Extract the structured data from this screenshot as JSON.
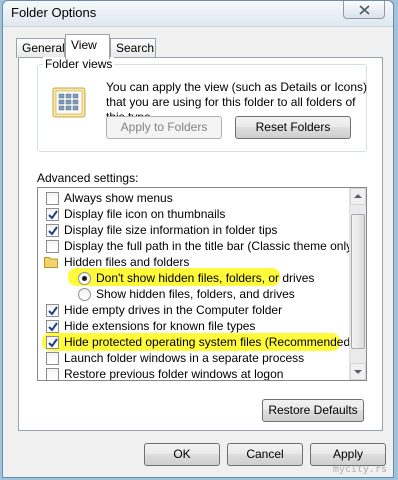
{
  "window": {
    "title": "Folder Options"
  },
  "tabs": [
    {
      "label": "General"
    },
    {
      "label": "View"
    },
    {
      "label": "Search"
    }
  ],
  "folder_views": {
    "legend": "Folder views",
    "description": "You can apply the view (such as Details or Icons) that you are using for this folder to all folders of this type.",
    "apply_button": "Apply to Folders",
    "reset_button": "Reset Folders"
  },
  "advanced": {
    "label": "Advanced settings:",
    "items": [
      {
        "label": "Always show menus",
        "kind": "checkbox",
        "checked": false,
        "indent": 1
      },
      {
        "label": "Display file icon on thumbnails",
        "kind": "checkbox",
        "checked": true,
        "indent": 1
      },
      {
        "label": "Display file size information in folder tips",
        "kind": "checkbox",
        "checked": true,
        "indent": 1
      },
      {
        "label": "Display the full path in the title bar (Classic theme only)",
        "kind": "checkbox",
        "checked": false,
        "indent": 1
      },
      {
        "label": "Hidden files and folders",
        "kind": "folder",
        "indent": 1
      },
      {
        "label": "Don't show hidden files, folders, or drives",
        "kind": "radio",
        "checked": true,
        "indent": 2,
        "highlight": true
      },
      {
        "label": "Show hidden files, folders, and drives",
        "kind": "radio",
        "checked": false,
        "indent": 2
      },
      {
        "label": "Hide empty drives in the Computer folder",
        "kind": "checkbox",
        "checked": true,
        "indent": 1
      },
      {
        "label": "Hide extensions for known file types",
        "kind": "checkbox",
        "checked": true,
        "indent": 1
      },
      {
        "label": "Hide protected operating system files (Recommended)",
        "kind": "checkbox",
        "checked": true,
        "indent": 1,
        "highlight": true
      },
      {
        "label": "Launch folder windows in a separate process",
        "kind": "checkbox",
        "checked": false,
        "indent": 1
      },
      {
        "label": "Restore previous folder windows at logon",
        "kind": "checkbox",
        "checked": false,
        "indent": 1
      }
    ],
    "restore_button": "Restore Defaults"
  },
  "footer": {
    "ok": "OK",
    "cancel": "Cancel",
    "apply": "Apply"
  },
  "watermark": "mycity.rs",
  "colors": {
    "highlight": "#fffb3b",
    "check": "#1c3f8c"
  },
  "icons": {
    "close": "close-icon",
    "folder_views": "folder-views-icon",
    "folder": "folder-icon"
  }
}
